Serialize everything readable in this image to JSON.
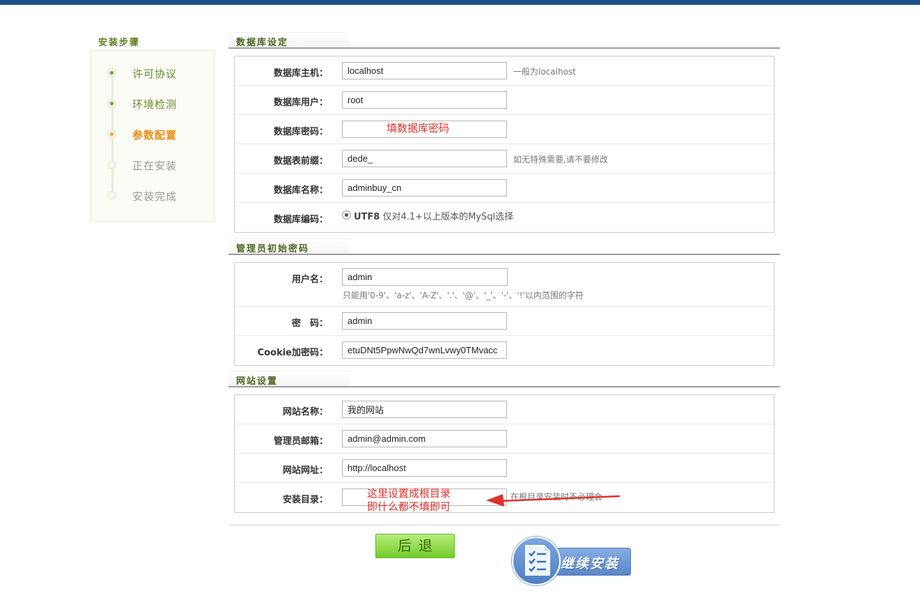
{
  "sidebar": {
    "title": "安装步骤",
    "steps": [
      {
        "label": "许可协议",
        "state": "done"
      },
      {
        "label": "环境检测",
        "state": "done"
      },
      {
        "label": "参数配置",
        "state": "active"
      },
      {
        "label": "正在安装",
        "state": "pending"
      },
      {
        "label": "安装完成",
        "state": "pending"
      }
    ]
  },
  "db": {
    "title": "数据库设定",
    "host_label": "数据库主机：",
    "host_value": "localhost",
    "host_hint": "一般为localhost",
    "user_label": "数据库用户：",
    "user_value": "root",
    "pwd_label": "数据库密码：",
    "pwd_annotation": "填数据库密码",
    "prefix_label": "数据表前缀：",
    "prefix_value": "dede_",
    "prefix_hint": "如无特殊需要,请不要修改",
    "name_label": "数据库名称：",
    "name_value": "adminbuy_cn",
    "charset_label": "数据库编码：",
    "charset_value": "UTF8",
    "charset_hint": "仅对4.1+以上版本的MySql选择"
  },
  "admin": {
    "title": "管理员初始密码",
    "username_label": "用户名：",
    "username_value": "admin",
    "username_hint": "只能用'0-9'、'a-z'、'A-Z'、'.'、'@'、'_'、'-'、'!'以内范围的字符",
    "password_label": "密　码：",
    "password_value": "admin",
    "cookie_label": "Cookie加密码：",
    "cookie_value": "etuDNt5PpwNwQd7wnLvwy0TMvacc"
  },
  "site": {
    "title": "网站设置",
    "name_label": "网站名称：",
    "name_value": "我的网站",
    "email_label": "管理员邮箱：",
    "email_value": "admin@admin.com",
    "url_label": "网站网址：",
    "url_value": "http://localhost",
    "dir_label": "安装目录：",
    "dir_value": "",
    "dir_hint": "在根目录安装时不必理会",
    "dir_annotation_line1": "这里设置成根目录",
    "dir_annotation_line2": "即什么都不填即可"
  },
  "buttons": {
    "back": "后退",
    "continue": "继续安装"
  },
  "colors": {
    "topbar": "#1c4f8c",
    "annotation": "#e0302a",
    "step_done": "#6aa124",
    "step_active": "#f0a43a"
  }
}
